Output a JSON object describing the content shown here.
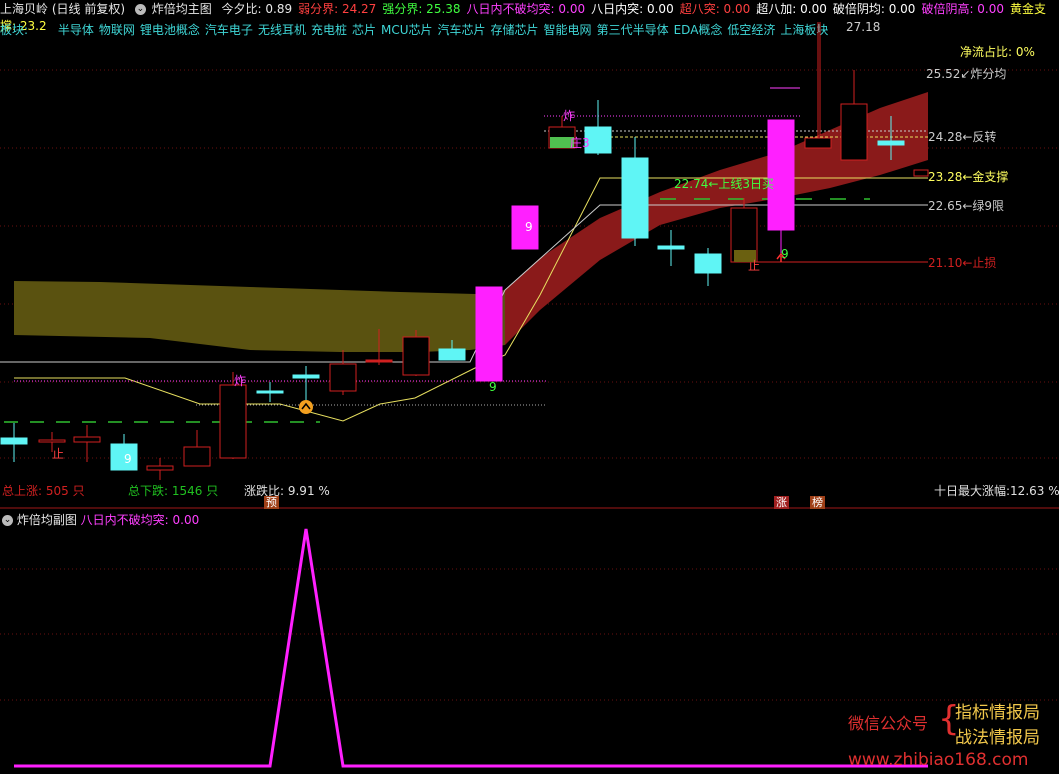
{
  "header": {
    "stock": "上海贝岭",
    "period": "(日线 前复权)",
    "indicator": "炸倍均主图",
    "items": [
      {
        "label": "今夕比:",
        "value": "0.89",
        "color": "#e8e8e8"
      },
      {
        "label": "弱分界:",
        "value": "24.27",
        "color": "#ff4040"
      },
      {
        "label": "强分界:",
        "value": "25.38",
        "color": "#40ff40"
      },
      {
        "label": "八日内不破均突:",
        "value": "0.00",
        "color": "#ff40ff"
      },
      {
        "label": "八日内突:",
        "value": "0.00",
        "color": "#ffffff"
      },
      {
        "label": "超八突:",
        "value": "0.00",
        "color": "#ff4040"
      },
      {
        "label": "超八加:",
        "value": "0.00",
        "color": "#ffffff"
      },
      {
        "label": "破倍阴均:",
        "value": "0.00",
        "color": "#ffffff"
      },
      {
        "label": "破倍阴高:",
        "value": "0.00",
        "color": "#ff40ff"
      },
      {
        "label": "黄金支撑:",
        "value": "23.2",
        "color": "#ffff40"
      }
    ]
  },
  "boards": {
    "label": "板块:",
    "items": [
      "半导体",
      "物联网",
      "锂电池概念",
      "汽车电子",
      "无线耳机",
      "充电桩",
      "芯片",
      "MCU芯片",
      "汽车芯片",
      "存储芯片",
      "智能电网",
      "第三代半导体",
      "EDA概念",
      "低空经济",
      "上海板块"
    ]
  },
  "main": {
    "price_labels": [
      {
        "text": "27.18",
        "color": "#cccccc"
      },
      {
        "text": "净流占比: 0%",
        "color": "#ffff60"
      },
      {
        "text": "25.52↙炸分均",
        "color": "#cccccc"
      },
      {
        "text": "24.28←反转",
        "color": "#cccccc"
      },
      {
        "text": "23.28←金支撑",
        "color": "#ffff60"
      },
      {
        "text": "22.65←绿9限",
        "color": "#cccccc"
      },
      {
        "text": "21.10←止损",
        "color": "#d02020"
      },
      {
        "text": "22.74←上线3日买",
        "color": "#40ff40"
      },
      {
        "text": "炸",
        "color": "#ff40ff"
      },
      {
        "text": "炸",
        "color": "#ff40ff"
      },
      {
        "text": "庄3",
        "color": "#ff40ff"
      },
      {
        "text": "止",
        "color": "#ff4040"
      },
      {
        "text": "止",
        "color": "#ff4040"
      },
      {
        "text": "9",
        "color": "#ffffff"
      },
      {
        "text": "9",
        "color": "#ffffff"
      },
      {
        "text": "9",
        "color": "#40ff40"
      },
      {
        "text": "9",
        "color": "#40ff40"
      }
    ],
    "stats": {
      "up": "总上涨: 505 只",
      "down": "总下跌: 1546 只",
      "ratio": "涨跌比: 9.91 %",
      "max": "十日最大涨幅:12.63 %"
    },
    "badges": {
      "yu": "预",
      "zhang": "涨",
      "bang": "榜"
    }
  },
  "sub": {
    "title": "炸倍均副图",
    "item_label": "八日内不破均突:",
    "item_value": "0.00",
    "series": [
      0,
      0,
      0,
      0,
      0,
      0,
      0,
      0,
      0,
      0,
      0,
      0,
      0,
      0,
      0,
      0,
      0,
      0,
      0,
      0,
      0,
      0,
      0,
      0,
      0,
      0,
      0,
      0,
      0,
      0,
      0,
      0,
      0,
      0,
      0,
      0,
      0,
      0,
      0,
      0,
      0,
      0,
      0,
      0,
      0,
      0,
      0,
      0,
      0,
      0,
      0,
      0,
      0,
      0,
      0,
      0,
      0,
      0,
      0,
      0,
      0,
      0,
      0,
      0,
      0,
      0,
      0,
      0,
      0,
      0,
      0,
      0,
      0,
      0,
      0,
      0,
      0,
      0,
      0,
      0,
      0,
      0,
      0,
      0,
      0,
      0,
      0,
      0,
      0,
      0,
      0,
      0,
      0,
      0,
      0,
      0,
      0,
      0,
      0,
      0
    ],
    "peak": 1,
    "line_color": "#ff20ff"
  },
  "candles": [
    {
      "o": 20.55,
      "h": 20.62,
      "c": 20.6,
      "l": 20.25,
      "col": "cyan"
    },
    {
      "o": 20.58,
      "h": 20.62,
      "c": 20.6,
      "l": 20.45,
      "col": "red"
    },
    {
      "o": 20.58,
      "h": 20.65,
      "c": 20.62,
      "l": 20.4,
      "col": "red"
    },
    {
      "o": 20.6,
      "h": 20.6,
      "c": 20.2,
      "l": 20.2,
      "col": "cyan"
    },
    {
      "o": 20.2,
      "h": 20.25,
      "c": 20.18,
      "l": 20.1,
      "col": "red"
    },
    {
      "o": 20.35,
      "h": 20.5,
      "c": 20.48,
      "l": 20.2,
      "col": "red"
    },
    {
      "o": 20.3,
      "h": 20.62,
      "c": 21.5,
      "l": 20.25,
      "col": "red"
    },
    {
      "o": 21.32,
      "h": 21.36,
      "c": 21.3,
      "l": 21.25,
      "col": "cyan"
    },
    {
      "o": 21.42,
      "h": 21.46,
      "c": 21.4,
      "l": 21.25,
      "col": "cyan"
    },
    {
      "o": 21.6,
      "h": 21.95,
      "c": 21.32,
      "l": 21.3,
      "col": "red"
    },
    {
      "o": 21.62,
      "h": 22.05,
      "c": 21.62,
      "l": 21.58,
      "col": "red"
    },
    {
      "o": 21.72,
      "h": 22.0,
      "c": 22.0,
      "l": 21.55,
      "col": "red"
    },
    {
      "o": 21.62,
      "h": 21.8,
      "c": 21.73,
      "l": 21.55,
      "col": "cyan"
    },
    {
      "o": 21.42,
      "h": 21.84,
      "c": 21.98,
      "l": 21.42,
      "col": "magenta"
    },
    {
      "o": 22.05,
      "h": 22.6,
      "c": 22.6,
      "l": 22.05,
      "col": "magenta"
    },
    {
      "o": 24.2,
      "h": 24.55,
      "c": 24.52,
      "l": 23.85,
      "col": "green"
    },
    {
      "o": 24.47,
      "h": 24.6,
      "c": 24.12,
      "l": 24.3,
      "col": "cyan"
    },
    {
      "o": 23.95,
      "h": 24.05,
      "c": 22.7,
      "l": 23.1,
      "col": "cyan"
    },
    {
      "o": 22.8,
      "h": 23.35,
      "c": 22.42,
      "l": 22.82,
      "col": "cyan"
    },
    {
      "o": 22.45,
      "h": 22.72,
      "c": 22.5,
      "l": 22.2,
      "col": "cyan"
    },
    {
      "o": 22.4,
      "h": 22.75,
      "c": 22.3,
      "l": 22.15,
      "col": "red"
    },
    {
      "o": 23.0,
      "h": 23.0,
      "c": 22.0,
      "l": 21.9,
      "col": "olive"
    },
    {
      "o": 24.65,
      "h": 24.65,
      "c": 22.7,
      "l": 22.6,
      "col": "magenta"
    },
    {
      "o": 24.2,
      "h": 27.2,
      "c": 24.1,
      "l": 24.2,
      "col": "red"
    },
    {
      "o": 25.2,
      "h": 25.8,
      "c": 24.4,
      "l": 25.2,
      "col": "red"
    },
    {
      "o": 24.25,
      "h": 24.6,
      "c": 24.4,
      "l": 23.85,
      "col": "cyan"
    }
  ]
}
